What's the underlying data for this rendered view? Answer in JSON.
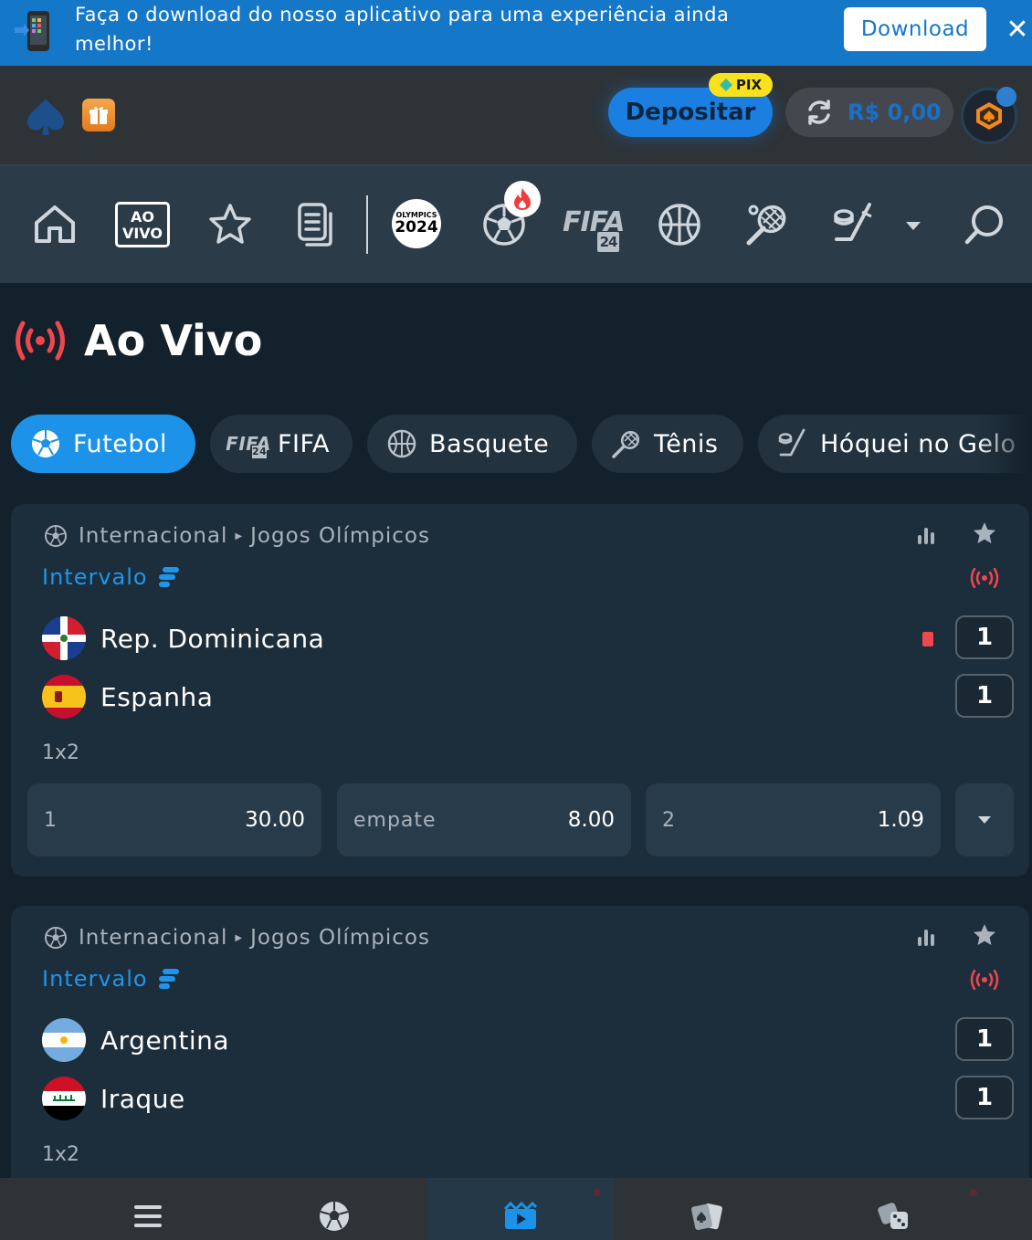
{
  "banner": {
    "message": "Faça o download do nosso aplicativo para uma experiência ainda melhor!",
    "download_label": "Download",
    "close_symbol": "✕",
    "icon": "mobile-phone-icon"
  },
  "header": {
    "deposit_label": "Depositar",
    "pix_label": "PIX",
    "balance": "R$ 0,00",
    "colors": {
      "deposit": "#1a7fe0",
      "pix": "#f7e21c",
      "balance": "#1a6fc9"
    }
  },
  "sport_nav": {
    "live_label_line1": "AO",
    "live_label_line2": "VIVO",
    "olympics_line1": "OLYMPICS",
    "olympics_line2": "2024",
    "fifa_label": "FIFA",
    "fifa_number": "24",
    "icons": [
      "home-icon",
      "live-icon",
      "star-icon",
      "betslip-icon",
      "olympics-icon",
      "football-icon",
      "fifa-icon",
      "basketball-icon",
      "tennis-icon",
      "hockey-icon",
      "chevron-down-icon",
      "search-icon"
    ]
  },
  "page": {
    "title": "Ao Vivo"
  },
  "chips": [
    {
      "label": "Futebol",
      "icon": "football-icon",
      "active": true
    },
    {
      "label": "FIFA",
      "icon": "fifa-icon",
      "active": false
    },
    {
      "label": "Basquete",
      "icon": "basketball-icon",
      "active": false
    },
    {
      "label": "Tênis",
      "icon": "tennis-icon",
      "active": false
    },
    {
      "label": "Hóquei no Gelo",
      "icon": "hockey-icon",
      "active": false
    }
  ],
  "chip_fifa_number": "24",
  "matches": [
    {
      "country": "Internacional",
      "league": "Jogos Olímpicos",
      "status": "Intervalo",
      "home": {
        "name": "Rep. Dominicana",
        "score": "1",
        "red_card": true
      },
      "away": {
        "name": "Espanha",
        "score": "1"
      },
      "market": "1x2",
      "odds": [
        {
          "label": "1",
          "value": "30.00"
        },
        {
          "label": "empate",
          "value": "8.00"
        },
        {
          "label": "2",
          "value": "1.09"
        }
      ]
    },
    {
      "country": "Internacional",
      "league": "Jogos Olímpicos",
      "status": "Intervalo",
      "home": {
        "name": "Argentina",
        "score": "1"
      },
      "away": {
        "name": "Iraque",
        "score": "1"
      },
      "market": "1x2"
    }
  ],
  "bottom_nav": [
    "menu-icon",
    "football-icon",
    "live-video-icon",
    "casino-cards-icon",
    "dice-icon"
  ],
  "colors": {
    "accent": "#1c93e8",
    "live_red": "#f0474f",
    "background": "#12212b",
    "card": "#1c2d3b"
  }
}
